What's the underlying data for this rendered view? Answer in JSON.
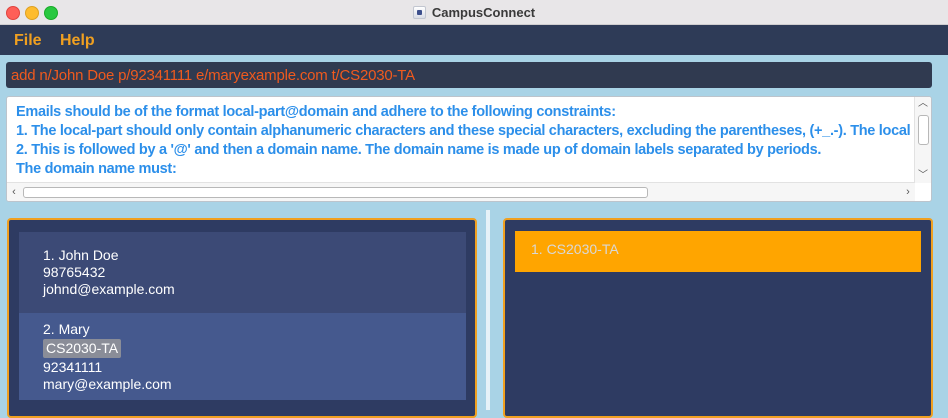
{
  "window": {
    "title": "CampusConnect"
  },
  "menu": {
    "items": [
      "File",
      "Help"
    ]
  },
  "command_box": {
    "value": "add n/John Doe p/92341111 e/maryexample.com t/CS2030-TA"
  },
  "result_display": {
    "lines": [
      "Emails should be of the format local-part@domain and adhere to the following constraints:",
      "1. The local-part should only contain alphanumeric characters and these special characters, excluding the parentheses, (+_.-). The local",
      "2. This is followed by a '@' and then a domain name. The domain name is made up of domain labels separated by periods.",
      "The domain name must:"
    ]
  },
  "person_list": [
    {
      "header": "1.  John Doe",
      "tags": [],
      "phone": "98765432",
      "email": "johnd@example.com"
    },
    {
      "header": "2.  Mary",
      "tags": [
        "CS2030-TA"
      ],
      "phone": "92341111",
      "email": "mary@example.com"
    }
  ],
  "tag_list": [
    {
      "label": "1.  CS2030-TA"
    }
  ],
  "colors": {
    "menu_bg": "#2e3b57",
    "accent_orange": "#f0a020",
    "command_text": "#f05a1e",
    "result_text": "#2c8fea",
    "pane_bg": "#2e3b62",
    "tag_row_bg": "#ffa500"
  },
  "icons": {
    "close": "close-window-icon",
    "minimize": "minimize-window-icon",
    "maximize": "maximize-window-icon",
    "app": "app-icon"
  }
}
